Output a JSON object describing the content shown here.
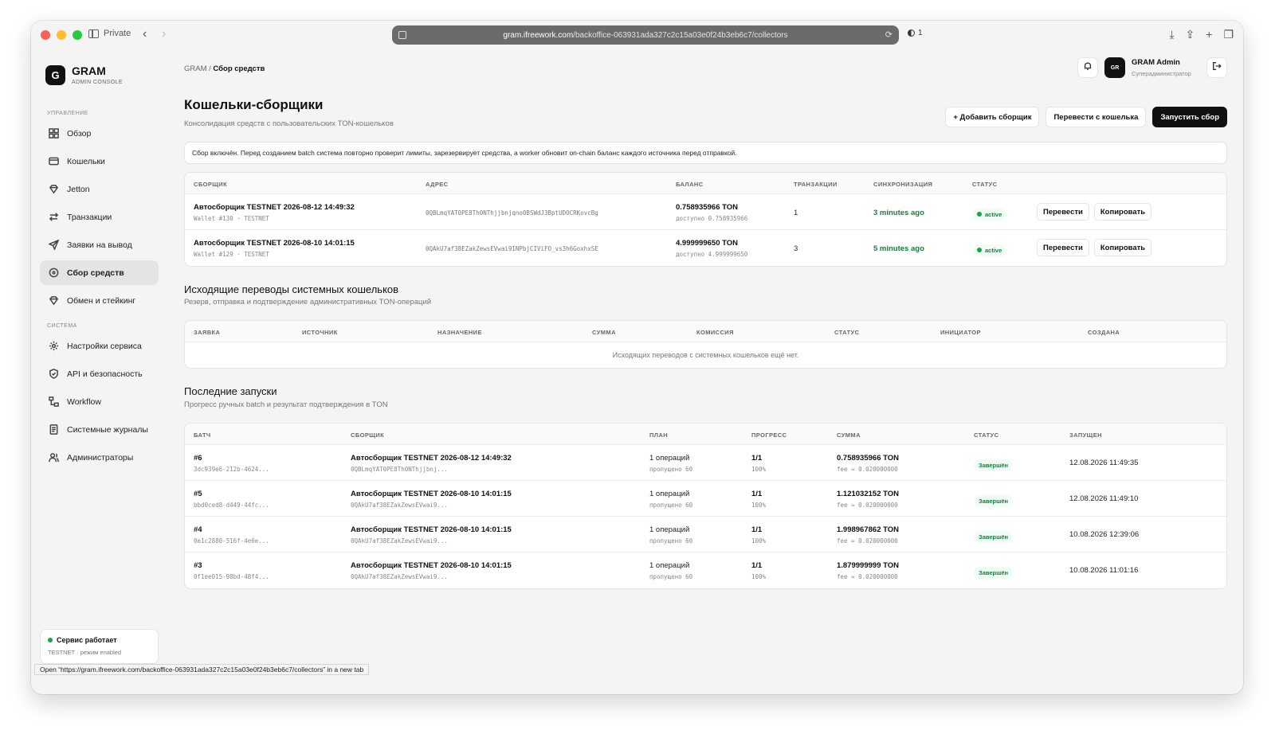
{
  "browser": {
    "private_label": "Private",
    "url_host": "gram.ifreework.com",
    "url_path": "/backoffice-063931ada327c2c15a03e0f24b3eb6c7/collectors",
    "ext_count": "1",
    "status_prefix": "Open “https://",
    "status_host": "gram.ifreework.com",
    "status_path": "/backoffice-063931ada327c2c15a03e0f24b3eb6c7/collectors” in a new tab"
  },
  "brand": {
    "logo": "G",
    "name": "GRAM",
    "sub": "ADMIN CONSOLE"
  },
  "sidebar": {
    "section_manage": "УПРАВЛЕНИЕ",
    "section_system": "СИСТЕМА",
    "items": [
      {
        "label": "Обзор",
        "icon": "grid-icon"
      },
      {
        "label": "Кошельки",
        "icon": "wallet-icon"
      },
      {
        "label": "Jetton",
        "icon": "diamond-icon"
      },
      {
        "label": "Транзакции",
        "icon": "arrows-icon"
      },
      {
        "label": "Заявки на вывод",
        "icon": "send-icon"
      },
      {
        "label": "Сбор средств",
        "icon": "circle-target-icon"
      },
      {
        "label": "Обмен и стейкинг",
        "icon": "diamond-icon"
      },
      {
        "label": "Настройки сервиса",
        "icon": "gear-icon"
      },
      {
        "label": "API и безопасность",
        "icon": "shield-icon"
      },
      {
        "label": "Workflow",
        "icon": "workflow-icon"
      },
      {
        "label": "Системные журналы",
        "icon": "document-icon"
      },
      {
        "label": "Администраторы",
        "icon": "users-icon"
      }
    ],
    "service_title": "Сервис работает",
    "service_sub": "TESTNET · режим enabled"
  },
  "header": {
    "breadcrumb_root": "GRAM",
    "breadcrumb_sep": " / ",
    "breadcrumb_current": "Сбор средств",
    "avatar": "GR",
    "user_name": "GRAM Admin",
    "user_role": "Суперадминистратор"
  },
  "page": {
    "title": "Кошельки-сборщики",
    "subtitle": "Консолидация средств с пользовательских TON-кошельков",
    "btn_add": "+ Добавить сборщик",
    "btn_transfer": "Перевести с кошелька",
    "btn_run": "Запустить сбор",
    "notice": "Сбор включён. Перед созданием batch система повторно проверит лимиты, зарезервирует средства, а worker обновит on-chain баланс каждого источника перед отправкой."
  },
  "collectors": {
    "headers": [
      "СБОРЩИК",
      "АДРЕС",
      "БАЛАНС",
      "ТРАНЗАКЦИИ",
      "СИНХРОНИЗАЦИЯ",
      "СТАТУС"
    ],
    "rows": [
      {
        "name": "Автосборщик TESTNET 2026-08-12 14:49:32",
        "sub": "Wallet #130 · TESTNET",
        "address": "0QBLmqYAT0PE8Th0NThjjbnjqno0BSWdJ3BptUDOCRKovcBg",
        "balance": "0.758935966 TON",
        "available": "доступно 0.758935966",
        "tx": "1",
        "sync": "3 minutes ago",
        "status": "active",
        "btn_transfer": "Перевести",
        "btn_copy": "Копировать"
      },
      {
        "name": "Автосборщик TESTNET 2026-08-10 14:01:15",
        "sub": "Wallet #129 · TESTNET",
        "address": "0QAkU7af38EZakZewsEVwai9INPbjCIViFO_vs3h6GoxhxSE",
        "balance": "4.999999650 TON",
        "available": "доступно 4.999999650",
        "tx": "3",
        "sync": "5 minutes ago",
        "status": "active",
        "btn_transfer": "Перевести",
        "btn_copy": "Копировать"
      }
    ]
  },
  "outgoing": {
    "title": "Исходящие переводы системных кошельков",
    "subtitle": "Резерв, отправка и подтверждение административных TON-операций",
    "headers": [
      "ЗАЯВКА",
      "ИСТОЧНИК",
      "НАЗНАЧЕНИЕ",
      "СУММА",
      "КОМИССИЯ",
      "СТАТУС",
      "ИНИЦИАТОР",
      "СОЗДАНА"
    ],
    "empty": "Исходящих переводов с системных кошельков ещё нет."
  },
  "runs": {
    "title": "Последние запуски",
    "subtitle": "Прогресс ручных batch и результат подтверждения в TON",
    "headers": [
      "БАТЧ",
      "СБОРЩИК",
      "ПЛАН",
      "ПРОГРЕСС",
      "СУММА",
      "СТАТУС",
      "ЗАПУЩЕН"
    ],
    "rows": [
      {
        "batch": "#6",
        "batch_id": "3dc939e6-212b-4624...",
        "collector": "Автосборщик TESTNET 2026-08-12 14:49:32",
        "collector_addr": "0QBLmqYAT0PE8Th0NThjjbnj...",
        "plan": "1 операций",
        "plan_sub": "пропущено 60",
        "progress": "1/1",
        "progress_sub": "100%",
        "progress_fraction": 1.0,
        "amount": "0.758935966 TON",
        "fee": "fee ≈ 0.020000000",
        "status": "Завершён",
        "started": "12.08.2026 11:49:35"
      },
      {
        "batch": "#5",
        "batch_id": "bbd0ced8-d449-44fc...",
        "collector": "Автосборщик TESTNET 2026-08-10 14:01:15",
        "collector_addr": "0QAkU7af38EZakZewsEVwai9...",
        "plan": "1 операций",
        "plan_sub": "пропущено 60",
        "progress": "1/1",
        "progress_sub": "100%",
        "progress_fraction": 1.0,
        "amount": "1.121032152 TON",
        "fee": "fee ≈ 0.020000000",
        "status": "Завершён",
        "started": "12.08.2026 11:49:10"
      },
      {
        "batch": "#4",
        "batch_id": "0e1c2880-516f-4e6e...",
        "collector": "Автосборщик TESTNET 2026-08-10 14:01:15",
        "collector_addr": "0QAkU7af38EZakZewsEVwai9...",
        "plan": "1 операций",
        "plan_sub": "пропущено 60",
        "progress": "1/1",
        "progress_sub": "100%",
        "progress_fraction": 1.0,
        "amount": "1.998967862 TON",
        "fee": "fee ≈ 0.020000000",
        "status": "Завершён",
        "started": "10.08.2026 12:39:06"
      },
      {
        "batch": "#3",
        "batch_id": "0f1ee015-98bd-48f4...",
        "collector": "Автосборщик TESTNET 2026-08-10 14:01:15",
        "collector_addr": "0QAkU7af38EZakZewsEVwai9...",
        "plan": "1 операций",
        "plan_sub": "пропущено 60",
        "progress": "1/1",
        "progress_sub": "100%",
        "progress_fraction": 1.0,
        "amount": "1.879999999 TON",
        "fee": "fee ≈ 0.020000000",
        "status": "Завершён",
        "started": "10.08.2026 11:01:16"
      }
    ]
  },
  "colors": {
    "accent": "#111111",
    "success": "#15803d",
    "success_bg": "#f0fdf4",
    "background": "#f4f4f5"
  }
}
